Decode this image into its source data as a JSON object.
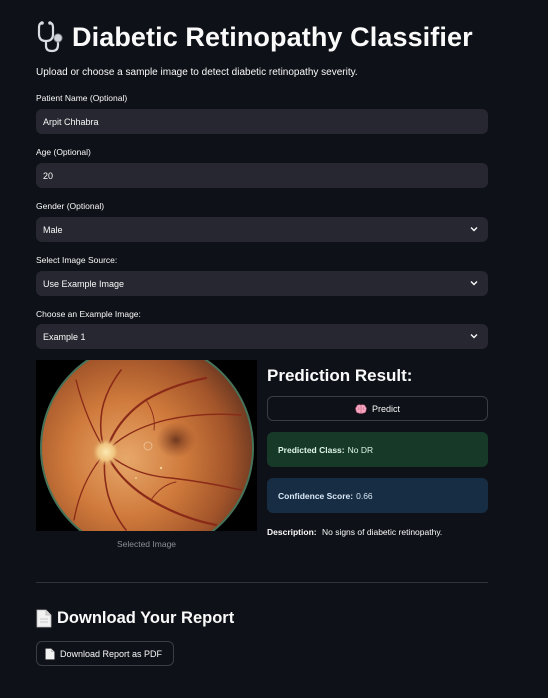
{
  "header": {
    "title": "Diabetic Retinopathy Classifier",
    "icon": "stethoscope-icon",
    "subtitle": "Upload or choose a sample image to detect diabetic retinopathy severity."
  },
  "form": {
    "patient_name": {
      "label": "Patient Name (Optional)",
      "value": "Arpit Chhabra"
    },
    "age": {
      "label": "Age (Optional)",
      "value": "20"
    },
    "gender": {
      "label": "Gender (Optional)",
      "value": "Male"
    },
    "image_source": {
      "label": "Select Image Source:",
      "value": "Use Example Image"
    },
    "example_image": {
      "label": "Choose an Example Image:",
      "value": "Example 1"
    }
  },
  "image": {
    "caption": "Selected Image"
  },
  "prediction": {
    "title": "Prediction Result:",
    "predict_button": "Predict",
    "predict_icon": "brain-icon",
    "class_label": "Predicted Class:",
    "class_value": "No DR",
    "confidence_label": "Confidence Score:",
    "confidence_value": "0.66",
    "description_label": "Description:",
    "description_value": "No signs of diabetic retinopathy."
  },
  "report": {
    "title": "Download Your Report",
    "title_icon": "document-icon",
    "download_button": "Download Report as PDF",
    "button_icon": "document-icon"
  },
  "colors": {
    "background": "#0e1117",
    "input_bg": "#262730",
    "success_bg": "#173928",
    "info_bg": "#172d43"
  }
}
